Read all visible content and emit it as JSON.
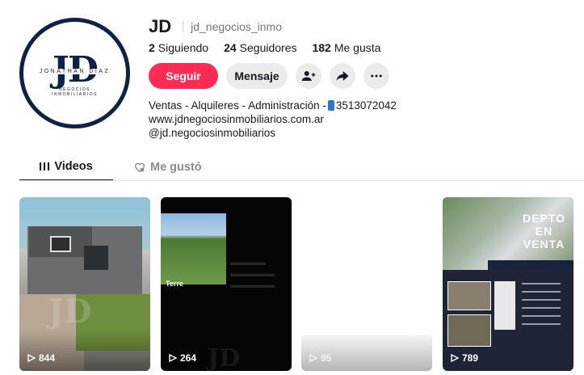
{
  "profile": {
    "username": "JD",
    "nickname": "jd_negocios_inmo",
    "avatar": {
      "monogram": "JD",
      "name": "JONATHAN DIAZ",
      "subtitle": "NEGOCIOS INMOBILIARIOS"
    },
    "stats": {
      "following_count": "2",
      "following_label": "Siguiendo",
      "followers_count": "24",
      "followers_label": "Seguidores",
      "likes_count": "182",
      "likes_label": "Me gusta"
    },
    "bio": {
      "line1_prefix": "Ventas - Alquileres - Administración -",
      "line1_phone": "3513072042",
      "line2": "www.jdnegociosinmobiliarios.com.ar",
      "line3": "@jd.negociosinmobiliarios"
    }
  },
  "actions": {
    "follow_label": "Seguir",
    "message_label": "Mensaje",
    "add_friend_icon": "person-plus-icon",
    "share_icon": "share-arrow-icon",
    "more_icon": "ellipsis-icon"
  },
  "tabs": [
    {
      "label": "Videos",
      "icon": "grid-icon",
      "active": true
    },
    {
      "label": "Me gustó",
      "icon": "heart-lock-icon",
      "active": false
    }
  ],
  "videos": [
    {
      "views": "844",
      "watermark": "JD"
    },
    {
      "views": "264",
      "overlay_text": "Terre",
      "watermark": "JD"
    },
    {
      "views": "95"
    },
    {
      "views": "789",
      "overlay_title_line1": "DEPTO",
      "overlay_title_line2": "EN",
      "overlay_title_line3": "VENTA"
    }
  ],
  "colors": {
    "accent": "#fe2c55",
    "text": "#161823",
    "secondary_text": "#73757d",
    "button_bg": "#ebebec",
    "brand_navy": "#0e2247"
  }
}
